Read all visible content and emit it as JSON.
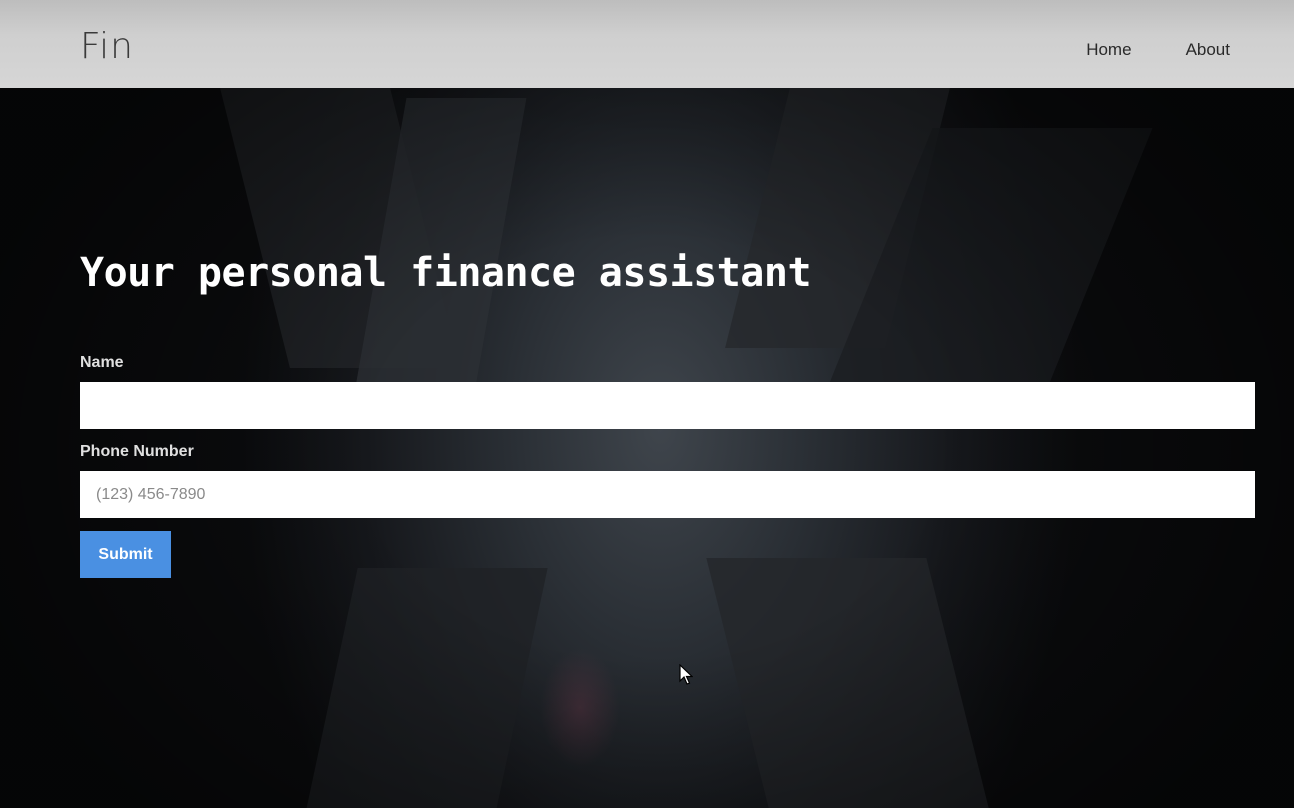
{
  "header": {
    "logo": "Fin",
    "nav": [
      {
        "label": "Home"
      },
      {
        "label": "About"
      }
    ]
  },
  "hero": {
    "headline": "Your personal finance assistant"
  },
  "form": {
    "name": {
      "label": "Name",
      "value": "",
      "placeholder": ""
    },
    "phone": {
      "label": "Phone Number",
      "value": "",
      "placeholder": "(123) 456-7890"
    },
    "submit_label": "Submit"
  },
  "colors": {
    "header_bg": "#d6d6d6",
    "accent": "#4a90e2",
    "hero_bg": "#16181c"
  },
  "icons": {
    "cursor": "mouse-pointer-icon"
  }
}
